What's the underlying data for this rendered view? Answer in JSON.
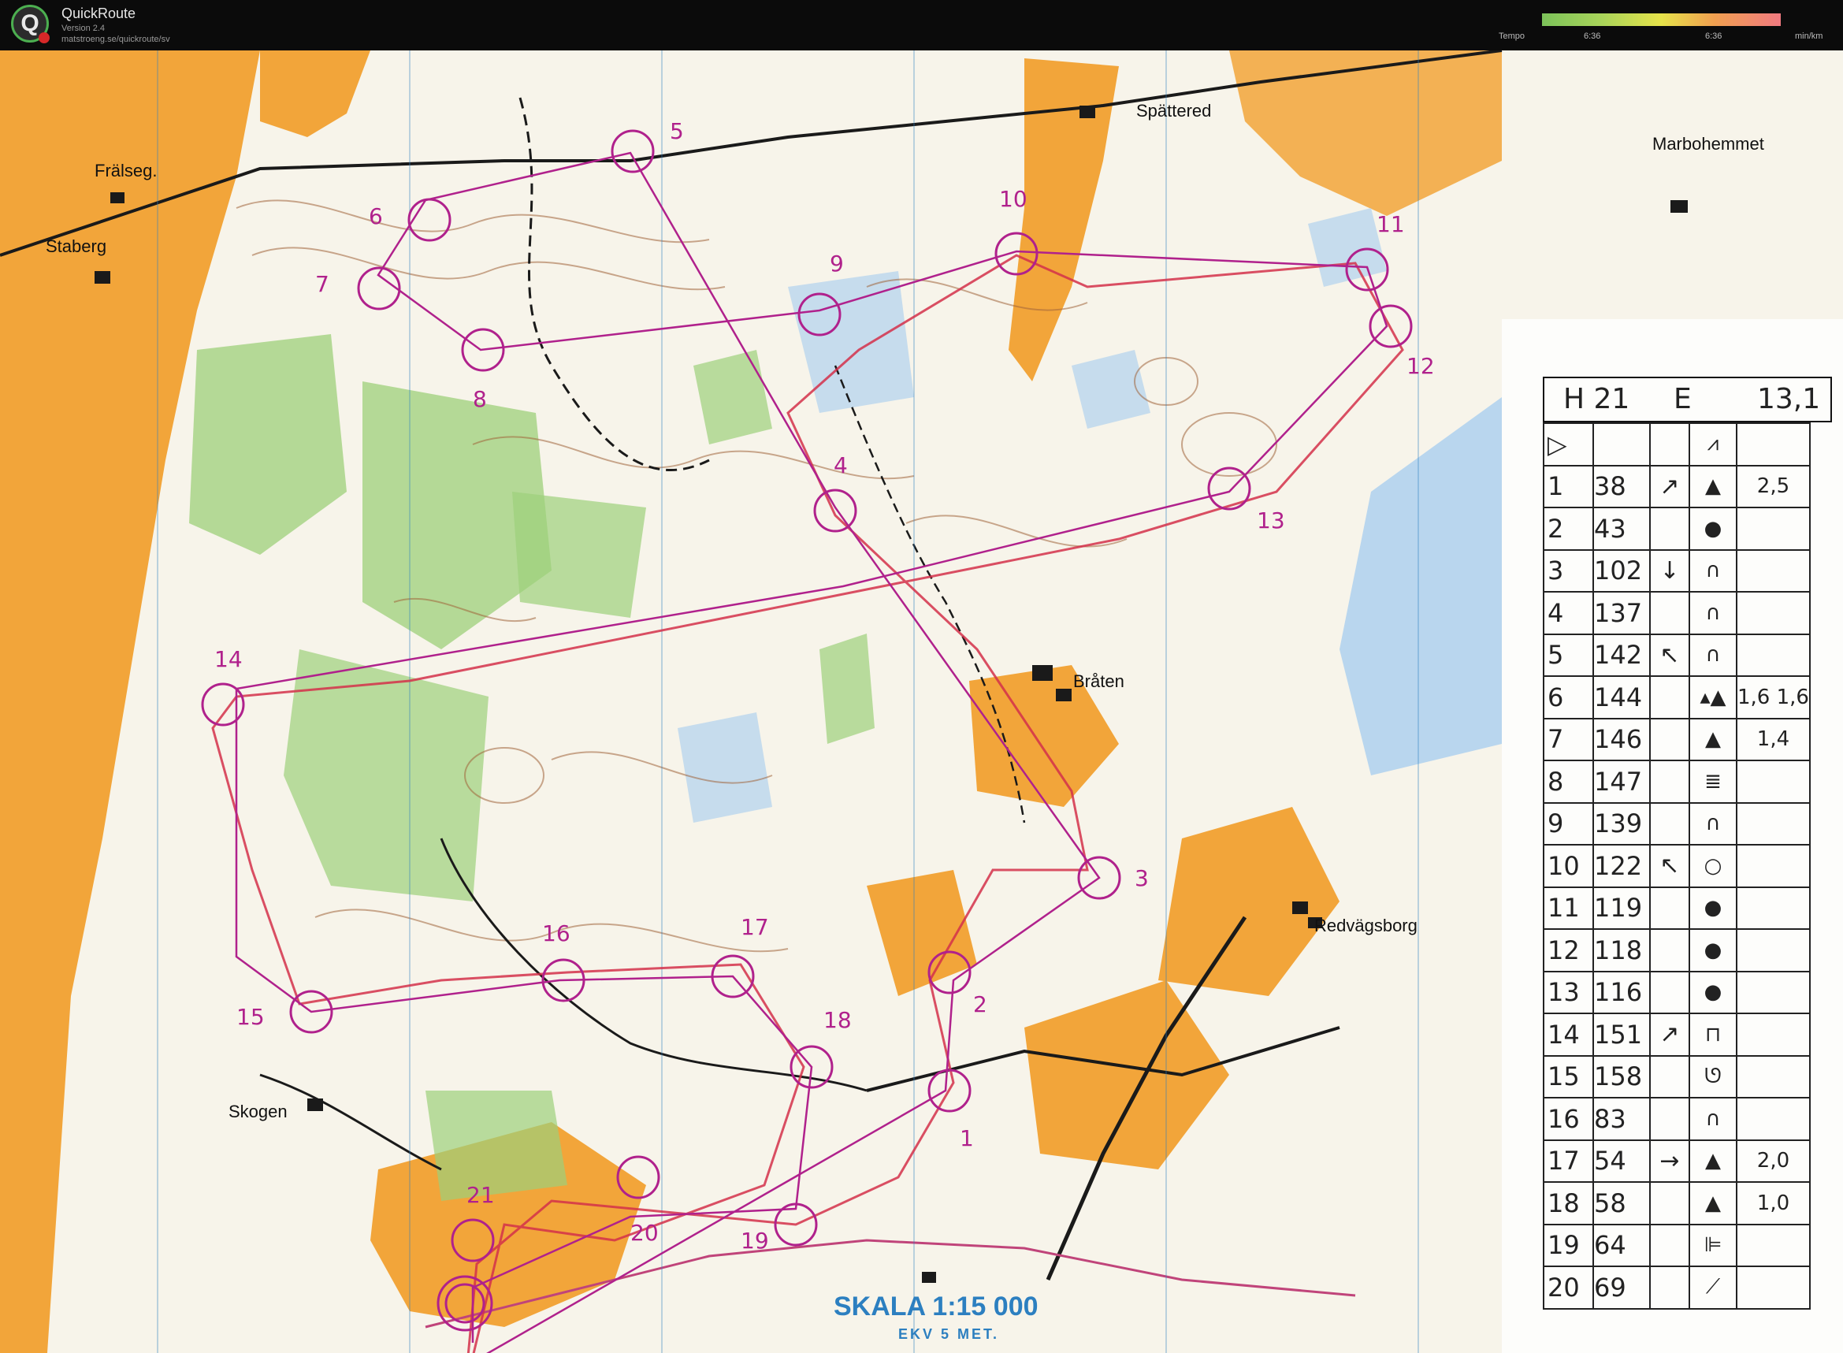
{
  "app": {
    "name": "QuickRoute",
    "version": "Version 2.4",
    "url": "matstroeng.se/quickroute/sv",
    "logo_letter": "Q"
  },
  "tempo": {
    "label": "Tempo",
    "mark_low": "6:36",
    "mark_high": "6:36",
    "unit": "min/km",
    "gradient_colors": [
      "#7cc25a",
      "#e6e24a",
      "#f07a80"
    ]
  },
  "map": {
    "places": {
      "spattered": "Spättered",
      "marbohemmet": "Marbohemmet",
      "fralseg": "Frälseg.",
      "staberg": "Staberg",
      "braten": "Bråten",
      "redvagsborg": "Redvägsborg",
      "skogen": "Skogen"
    },
    "scale": "SKALA 1:15 000",
    "contour": "EKV  5 MET.",
    "control_numbers": [
      "1",
      "2",
      "3",
      "4",
      "5",
      "6",
      "7",
      "8",
      "9",
      "10",
      "11",
      "12",
      "13",
      "14",
      "15",
      "16",
      "17",
      "18",
      "19",
      "20",
      "21"
    ],
    "colors": {
      "course": "#b0218c",
      "route": "#d4304a",
      "open_land": "#f2a53a",
      "forest": "#ffffff",
      "green": "#9dd07a",
      "water": "#b9d6ee"
    }
  },
  "control_card": {
    "class": "H 21",
    "level": "E",
    "length": "13,1",
    "start_symbol": "▷",
    "start_feature": "⩘",
    "rows": [
      {
        "no": "1",
        "code": "38",
        "dir": "↗",
        "sym": "▲",
        "dist": "2,5"
      },
      {
        "no": "2",
        "code": "43",
        "dir": "",
        "sym": "●",
        "dist": ""
      },
      {
        "no": "3",
        "code": "102",
        "dir": "↓",
        "sym": "∩",
        "dist": ""
      },
      {
        "no": "4",
        "code": "137",
        "dir": "",
        "sym": "∩",
        "dist": ""
      },
      {
        "no": "5",
        "code": "142",
        "dir": "↖",
        "sym": "∩",
        "dist": ""
      },
      {
        "no": "6",
        "code": "144",
        "dir": "",
        "sym": "▴▲",
        "dist": "1,6 1,6"
      },
      {
        "no": "7",
        "code": "146",
        "dir": "",
        "sym": "▲",
        "dist": "1,4"
      },
      {
        "no": "8",
        "code": "147",
        "dir": "",
        "sym": "≣",
        "dist": ""
      },
      {
        "no": "9",
        "code": "139",
        "dir": "",
        "sym": "∩",
        "dist": ""
      },
      {
        "no": "10",
        "code": "122",
        "dir": "↖",
        "sym": "○",
        "dist": ""
      },
      {
        "no": "11",
        "code": "119",
        "dir": "",
        "sym": "●",
        "dist": ""
      },
      {
        "no": "12",
        "code": "118",
        "dir": "",
        "sym": "●",
        "dist": ""
      },
      {
        "no": "13",
        "code": "116",
        "dir": "",
        "sym": "●",
        "dist": ""
      },
      {
        "no": "14",
        "code": "151",
        "dir": "↗",
        "sym": "⊓",
        "dist": ""
      },
      {
        "no": "15",
        "code": "158",
        "dir": "",
        "sym": "ᘎ",
        "dist": ""
      },
      {
        "no": "16",
        "code": "83",
        "dir": "",
        "sym": "∩",
        "dist": ""
      },
      {
        "no": "17",
        "code": "54",
        "dir": "→",
        "sym": "▲",
        "dist": "2,0"
      },
      {
        "no": "18",
        "code": "58",
        "dir": "",
        "sym": "▲",
        "dist": "1,0"
      },
      {
        "no": "19",
        "code": "64",
        "dir": "",
        "sym": "⊫",
        "dist": ""
      },
      {
        "no": "20",
        "code": "69",
        "dir": "",
        "sym": "⟋",
        "dist": ""
      }
    ]
  }
}
